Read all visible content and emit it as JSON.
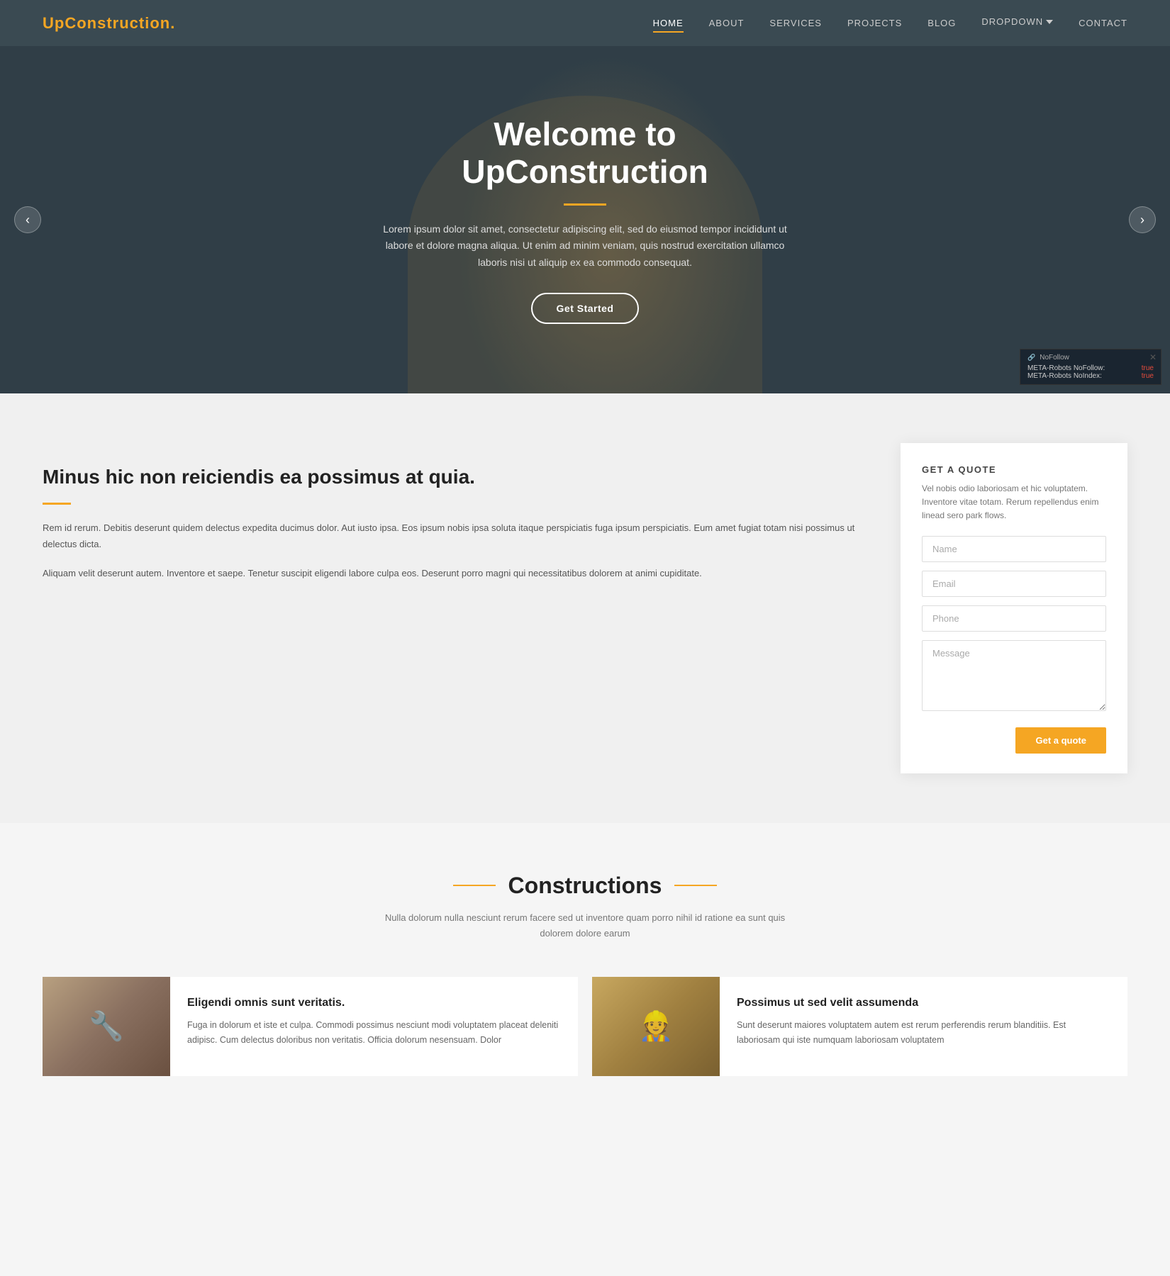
{
  "nav": {
    "logo": "UpConstruction",
    "logo_dot": ".",
    "links": [
      {
        "id": "home",
        "label": "HOME",
        "active": true
      },
      {
        "id": "about",
        "label": "ABOUT",
        "active": false
      },
      {
        "id": "services",
        "label": "SERVICES",
        "active": false
      },
      {
        "id": "projects",
        "label": "PROJECTS",
        "active": false
      },
      {
        "id": "blog",
        "label": "BLOG",
        "active": false
      },
      {
        "id": "dropdown",
        "label": "DROPDOWN",
        "has_arrow": true,
        "active": false
      },
      {
        "id": "contact",
        "label": "CONTACT",
        "active": false
      }
    ]
  },
  "hero": {
    "title": "Welcome to UpConstruction",
    "body": "Lorem ipsum dolor sit amet, consectetur adipiscing elit, sed do eiusmod tempor incididunt ut labore et dolore magna aliqua. Ut enim ad minim veniam, quis nostrud exercitation ullamco laboris nisi ut aliquip ex ea commodo consequat.",
    "cta_label": "Get Started",
    "arrow_left": "‹",
    "arrow_right": "›"
  },
  "meta_badge": {
    "title": "NoFollow",
    "rows": [
      {
        "label": "META-Robots NoFollow:",
        "value": "true"
      },
      {
        "label": "META-Robots NoIndex:",
        "value": "true"
      }
    ]
  },
  "middle": {
    "heading": "Minus hic non reiciendis ea possimus at quia.",
    "para1": "Rem id rerum. Debitis deserunt quidem delectus expedita ducimus dolor. Aut iusto ipsa. Eos ipsum nobis ipsa soluta itaque perspiciatis fuga ipsum perspiciatis. Eum amet fugiat totam nisi possimus ut delectus dicta.",
    "para2": "Aliquam velit deserunt autem. Inventore et saepe. Tenetur suscipit eligendi labore culpa eos. Deserunt porro magni qui necessitatibus dolorem at animi cupiditate."
  },
  "quote": {
    "heading": "GET A QUOTE",
    "description": "Vel nobis odio laboriosam et hic voluptatem. Inventore vitae totam. Rerum repellendus enim linead sero park flows.",
    "name_placeholder": "Name",
    "email_placeholder": "Email",
    "phone_placeholder": "Phone",
    "message_placeholder": "Message",
    "button_label": "Get a quote"
  },
  "constructions": {
    "heading": "Constructions",
    "subtext": "Nulla dolorum nulla nesciunt rerum facere sed ut inventore quam porro nihil id ratione ea sunt quis dolorem dolore earum",
    "cards": [
      {
        "id": "card1",
        "image_type": "tools",
        "title": "Eligendi omnis sunt veritatis.",
        "body": "Fuga in dolorum et iste et culpa. Commodi possimus nesciunt modi voluptatem placeat deleniti adipisc. Cum delectus doloribus non veritatis. Officia dolorum nesensuam. Dolor"
      },
      {
        "id": "card2",
        "image_type": "workers",
        "title": "Possimus ut sed velit assumenda",
        "body": "Sunt deserunt maiores voluptatem autem est rerum perferendis rerum blanditiis. Est laboriosam qui iste numquam laboriosam voluptatem"
      }
    ]
  }
}
